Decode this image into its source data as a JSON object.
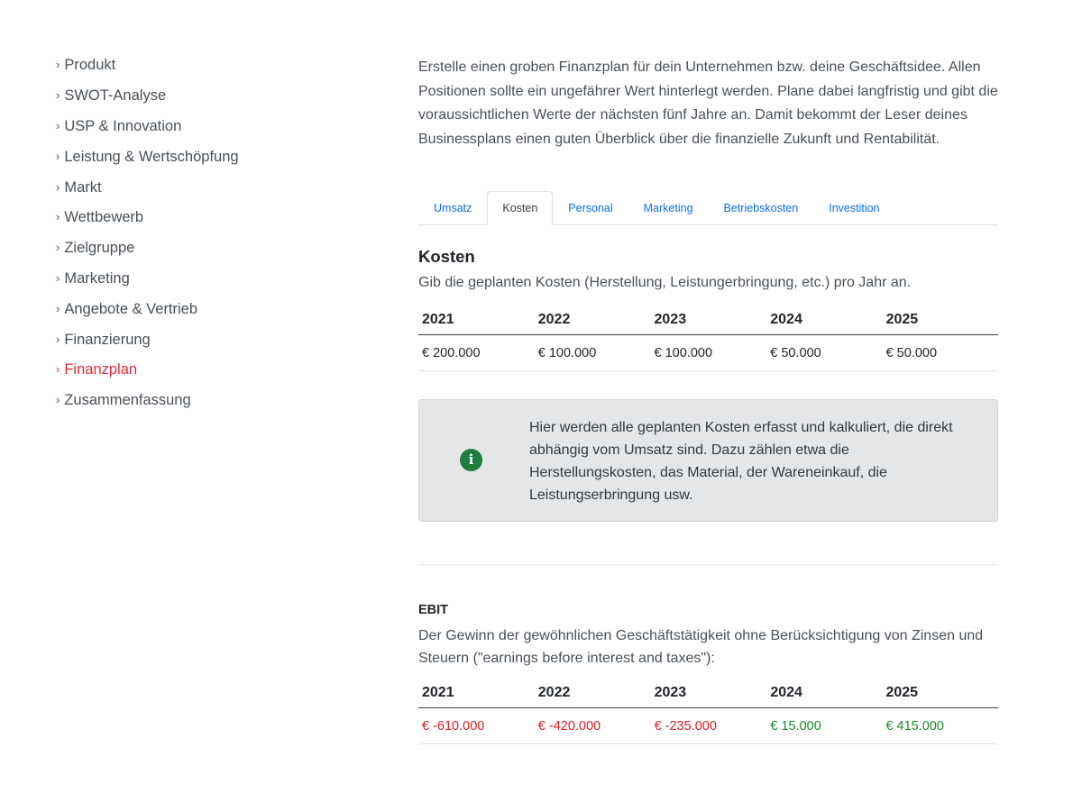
{
  "sidebar": {
    "items": [
      {
        "label": "Produkt"
      },
      {
        "label": "SWOT-Analyse"
      },
      {
        "label": "USP & Innovation"
      },
      {
        "label": "Leistung & Wertschöpfung"
      },
      {
        "label": "Markt"
      },
      {
        "label": "Wettbewerb"
      },
      {
        "label": "Zielgruppe"
      },
      {
        "label": "Marketing"
      },
      {
        "label": "Angebote & Vertrieb"
      },
      {
        "label": "Finanzierung"
      },
      {
        "label": "Finanzplan",
        "active": true
      },
      {
        "label": "Zusammenfassung"
      }
    ]
  },
  "intro": "Erstelle einen groben Finanzplan für dein Unternehmen bzw. deine Geschäftsidee. Allen Positionen sollte ein ungefährer Wert hinterlegt werden. Plane dabei langfristig und gibt die voraussichtlichen Werte der nächsten fünf Jahre an. Damit bekommt der Leser deines Businessplans einen guten Überblick über die finanzielle Zukunft und Rentabilität.",
  "tabs": [
    {
      "label": "Umsatz"
    },
    {
      "label": "Kosten",
      "active": true
    },
    {
      "label": "Personal"
    },
    {
      "label": "Marketing"
    },
    {
      "label": "Betriebskosten"
    },
    {
      "label": "Investition"
    }
  ],
  "kosten": {
    "title": "Kosten",
    "description": "Gib die geplanten Kosten (Herstellung, Leistungerbringung, etc.) pro Jahr an.",
    "years": [
      "2021",
      "2022",
      "2023",
      "2024",
      "2025"
    ],
    "values": [
      "€ 200.000",
      "€ 100.000",
      "€ 100.000",
      "€ 50.000",
      "€ 50.000"
    ]
  },
  "info": {
    "icon": "info-circle-icon",
    "icon_glyph": "i",
    "text": "Hier werden alle geplanten Kosten erfasst und kalkuliert, die direkt abhängig vom Umsatz sind. Dazu zählen etwa die Herstellungskosten, das Material, der Wareneinkauf, die Leistungserbringung usw."
  },
  "ebit": {
    "title": "EBIT",
    "description": "Der Gewinn der gewöhnlichen Geschäftstätigkeit ohne Berücksichtigung von Zinsen und Steuern (\"earnings before interest and taxes\"):",
    "years": [
      "2021",
      "2022",
      "2023",
      "2024",
      "2025"
    ],
    "values": [
      "€ -610.000",
      "€ -420.000",
      "€ -235.000",
      "€ 15.000",
      "€ 415.000"
    ],
    "negative_color": "#dc1d24",
    "positive_color": "#1c8a2e"
  },
  "colors": {
    "active_nav": "#e02a3c",
    "tab_link": "#0b6ef0",
    "info_icon": "#1f7d3e"
  }
}
